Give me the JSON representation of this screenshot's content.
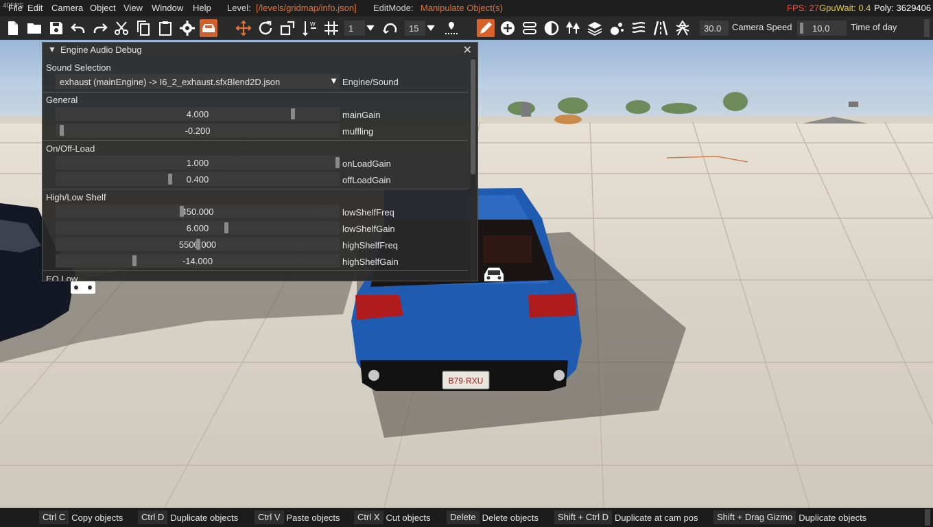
{
  "fps_overlay": "40FPS",
  "menubar": {
    "items": [
      "File",
      "Edit",
      "Camera",
      "Object",
      "View",
      "Window",
      "Help"
    ],
    "level_label": "Level:",
    "level_value": "[/levels/gridmap/info.json]",
    "editmode_label": "EditMode:",
    "editmode_value": "Manipulate Object(s)",
    "fps": "FPS: 27",
    "gpuwait": "GpuWait: 0.4",
    "poly": "Poly: 3629406"
  },
  "toolbar": {
    "step_value": "1",
    "angle_value": "15",
    "camera_speed_value": "30.0",
    "camera_speed_label": "Camera Speed",
    "time_of_day_value": "10.0",
    "time_of_day_label": "Time of day",
    "icons": [
      "new-file-icon",
      "open-folder-icon",
      "save-icon",
      "undo-icon",
      "redo-icon",
      "cut-icon",
      "copy-icon",
      "paste-icon",
      "settings-gear-icon",
      "vehicle-mode-icon",
      "translate-gizmo-icon",
      "rotate-gizmo-icon",
      "scale-gizmo-icon",
      "world-space-icon",
      "grid-snap-icon",
      "rotation-snap-icon",
      "drop-to-ground-icon",
      "pencil-icon",
      "add-object-icon",
      "road-editor-icon",
      "decal-icon",
      "forest-icon",
      "terrain-layers-icon",
      "particles-icon",
      "river-icon",
      "road-icon",
      "ai-path-icon"
    ]
  },
  "window": {
    "title": "Engine Audio Debug",
    "sound_selection_label": "Sound Selection",
    "combo_value": "exhaust (mainEngine) -> I6_2_exhaust.sfxBlend2D.json",
    "combo_label": "Engine/Sound",
    "sections": {
      "general": "General",
      "onoff": "On/Off-Load",
      "highlow": "High/Low Shelf",
      "eqlow": "EQ Low"
    },
    "rows": [
      {
        "value": "4.000",
        "label": "mainGain",
        "fraction": 0.84
      },
      {
        "value": "-0.200",
        "label": "muffling",
        "fraction": 0.01
      },
      {
        "value": "1.000",
        "label": "onLoadGain",
        "fraction": 1.0
      },
      {
        "value": "0.400",
        "label": "offLoadGain",
        "fraction": 0.4
      },
      {
        "value": "450.000",
        "label": "lowShelfFreq",
        "fraction": 0.44
      },
      {
        "value": "6.000",
        "label": "lowShelfGain",
        "fraction": 0.6
      },
      {
        "value": "5500.000",
        "label": "highShelfFreq",
        "fraction": 0.5
      },
      {
        "value": "-14.000",
        "label": "highShelfGain",
        "fraction": 0.27
      }
    ]
  },
  "scene": {
    "license_plate": "B79·RXU"
  },
  "statusbar": [
    {
      "key": "Ctrl C",
      "desc": "Copy objects"
    },
    {
      "key": "Ctrl D",
      "desc": "Duplicate objects"
    },
    {
      "key": "Ctrl V",
      "desc": "Paste objects"
    },
    {
      "key": "Ctrl X",
      "desc": "Cut objects"
    },
    {
      "key": "Delete",
      "desc": "Delete objects"
    },
    {
      "key": "Shift + Ctrl D",
      "desc": "Duplicate at cam pos"
    },
    {
      "key": "Shift + Drag Gizmo",
      "desc": "Duplicate objects"
    }
  ]
}
